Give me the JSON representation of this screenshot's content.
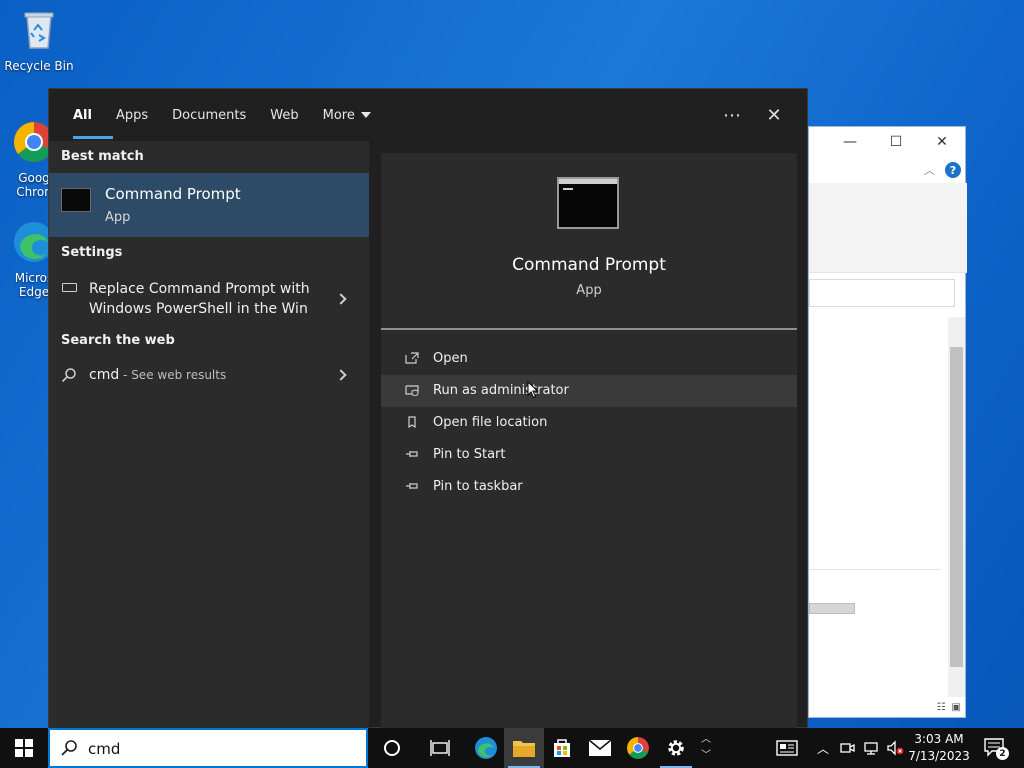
{
  "desktop": {
    "icons": [
      {
        "label": "Recycle Bin"
      },
      {
        "label": "Goog\nChron"
      },
      {
        "label": "Micros\nEdge"
      }
    ]
  },
  "search_panel": {
    "tabs": [
      {
        "label": "All",
        "active": true
      },
      {
        "label": "Apps"
      },
      {
        "label": "Documents"
      },
      {
        "label": "Web"
      },
      {
        "label": "More"
      }
    ],
    "options_icon": "ellipsis-icon",
    "close_icon": "close-icon",
    "best_match": {
      "header": "Best match",
      "title": "Command Prompt",
      "subtitle": "App"
    },
    "settings": {
      "header": "Settings",
      "item": "Replace Command Prompt with Windows PowerShell in the Win"
    },
    "web": {
      "header": "Search the web",
      "query": "cmd",
      "hint": " - See web results"
    },
    "preview": {
      "title": "Command Prompt",
      "subtitle": "App",
      "actions": [
        {
          "label": "Open",
          "icon": "open-icon"
        },
        {
          "label": "Run as administrator",
          "icon": "shield-icon",
          "hover": true
        },
        {
          "label": "Open file location",
          "icon": "file-location-icon"
        },
        {
          "label": "Pin to Start",
          "icon": "pin-icon"
        },
        {
          "label": "Pin to taskbar",
          "icon": "pin-icon"
        }
      ]
    }
  },
  "taskbar": {
    "search_value": "cmd",
    "clock": {
      "time": "3:03 AM",
      "date": "7/13/2023"
    },
    "notification_count": "2"
  },
  "colors": {
    "accent": "#0078d4",
    "best_match_highlight": "#2d4a66",
    "panel_bg": "#202020"
  }
}
